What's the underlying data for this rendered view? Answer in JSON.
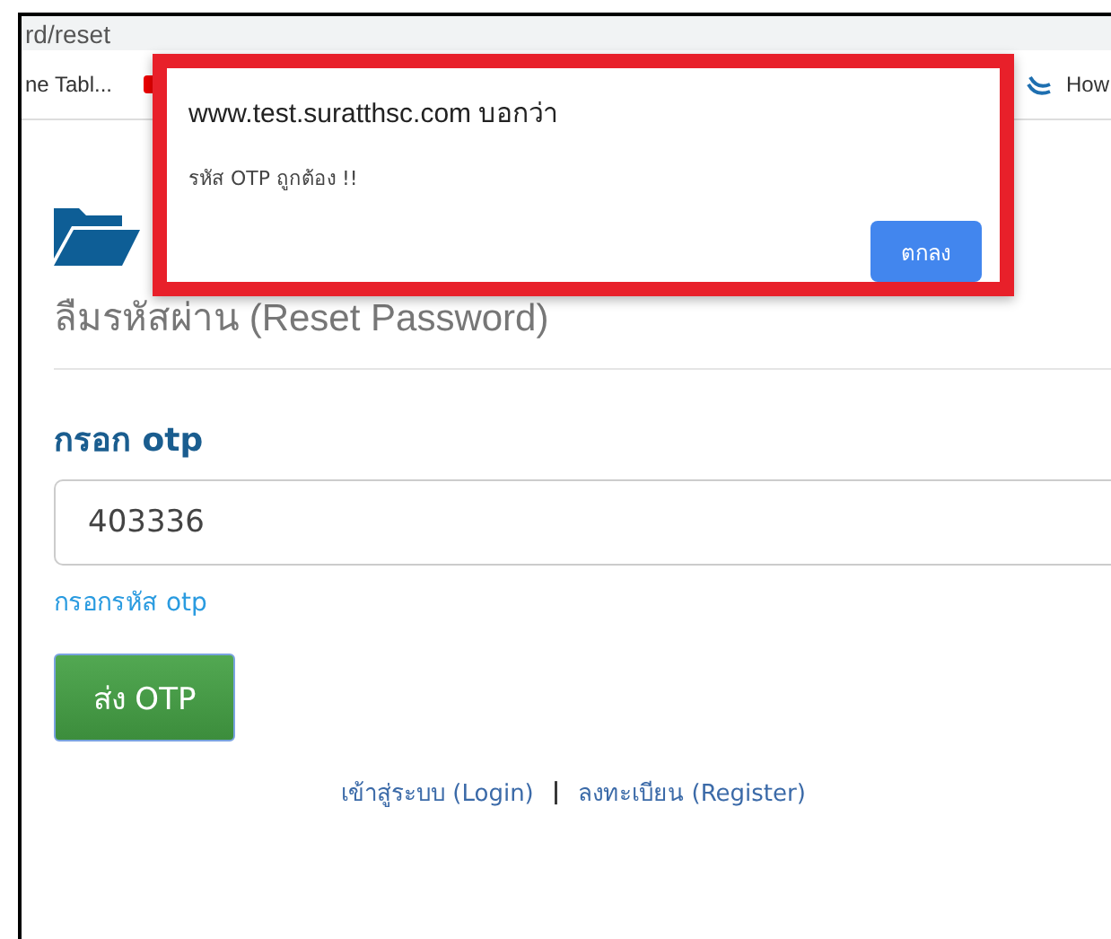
{
  "address_bar": {
    "url": "rd/reset"
  },
  "bookmarks": [
    {
      "label": "ne Tabl...",
      "kind": "text"
    },
    {
      "kind": "red"
    },
    {
      "label": "How",
      "kind": "swirl"
    }
  ],
  "dialog": {
    "title": "www.test.suratthsc.com บอกว่า",
    "message": "รหัส OTP ถูกต้อง !!",
    "button": "ตกลง",
    "highlighted": true
  },
  "page": {
    "heading": "ลืมรหัสผ่าน (Reset Password)",
    "field_label": "กรอก otp",
    "otp_value": "403336",
    "help": "กรอกรหัส otp",
    "submit": "ส่ง OTP",
    "links": [
      {
        "label": "เข้าสู่ระบบ (Login)"
      },
      {
        "label": "ลงทะเบียน (Register)"
      }
    ],
    "separator": "|"
  }
}
